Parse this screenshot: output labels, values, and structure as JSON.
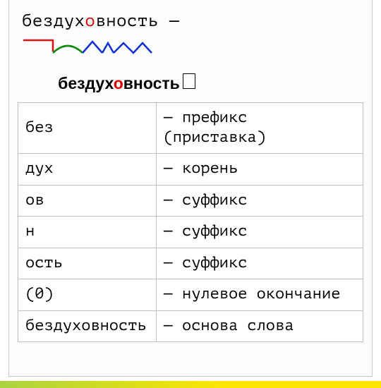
{
  "headline": {
    "pre": "бездух",
    "stress": "о",
    "post": "вность",
    "dash": "  —"
  },
  "morph_word": {
    "pre": "бездух",
    "stress": "о",
    "post": "вность"
  },
  "rows": [
    {
      "part": "без",
      "def": "— префикс (приставка)"
    },
    {
      "part": "дух",
      "def": "— корень"
    },
    {
      "part": "ов",
      "def": "— суффикс"
    },
    {
      "part": "н",
      "def": "— суффикс"
    },
    {
      "part": "ость",
      "def": "— суффикс"
    },
    {
      "part": "(0)",
      "def": "— нулевое окончание"
    },
    {
      "part": "бездуховность",
      "def": "— основа слова"
    }
  ]
}
